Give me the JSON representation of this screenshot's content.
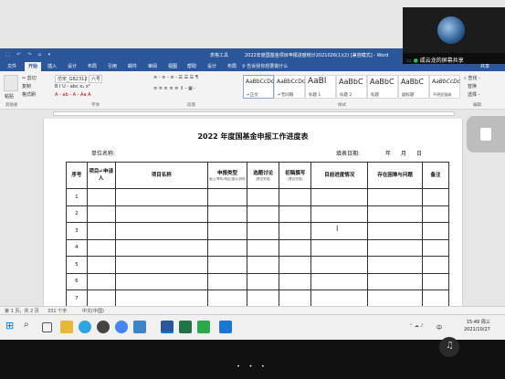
{
  "window": {
    "quick_access": "⬚ ↶ ↷ ⌂ ▾",
    "tools_tab": "表格工具",
    "doc_title": "2022年度国基金项目申报进度统计2021026(1)(2) [兼容模式] - Word"
  },
  "ribbon_tabs": [
    "文件",
    "开始",
    "插入",
    "设计",
    "布局",
    "引用",
    "邮件",
    "审阅",
    "视图",
    "帮助",
    "设计",
    "布局"
  ],
  "active_tab_index": 1,
  "tell_me": "告诉我你想要做什么",
  "share": "共享",
  "ribbon": {
    "paste": "粘贴",
    "cut": "✂ 剪切",
    "copy": "复制",
    "painter": "格式刷",
    "font_name": "仿宋_GB2312",
    "font_size": "六号",
    "font_buttons": "B I U - abc x₂ x²",
    "font_color_row": "A - ab - A - Aa A",
    "para_row1": "≡ - ≡ - ≡ - ☰ ☰ ☰ ¶",
    "para_row2": "≡ ≡ ≡ ≡ ≡ ↕ - ▦ -",
    "styles": [
      {
        "sample": "AaBbCcDc",
        "name": "↵正文"
      },
      {
        "sample": "AaBbCcDc",
        "name": "↵无间隔"
      },
      {
        "sample": "AaBl",
        "name": "标题 1"
      },
      {
        "sample": "AaBbC",
        "name": "标题 2"
      },
      {
        "sample": "AaBbC",
        "name": "标题"
      },
      {
        "sample": "AaBbC",
        "name": "副标题"
      },
      {
        "sample": "AaBbCcDc",
        "name": "不明显强调"
      }
    ],
    "find": "⌕ 查找 -",
    "replace": "替换",
    "select": "选择 -",
    "groups": [
      "剪贴板",
      "字体",
      "段落",
      "样式",
      "编辑"
    ]
  },
  "document": {
    "title": "2022 年度国基金申报工作进度表",
    "unit_label": "单位名称:",
    "date_label": "填表日期:",
    "year": "年",
    "month": "月",
    "day": "日",
    "headers": [
      {
        "label": "序号",
        "sub": ""
      },
      {
        "label": "项目↵申请人",
        "sub": ""
      },
      {
        "label": "项目名称",
        "sub": ""
      },
      {
        "label": "申报类型",
        "sub": "面上/青年/地区/重点/其他"
      },
      {
        "label": "选题讨论",
        "sub": "(是否完成)"
      },
      {
        "label": "初稿撰写",
        "sub": "(是否完成)"
      },
      {
        "label": "目前进度情况",
        "sub": ""
      },
      {
        "label": "存在困难与问题",
        "sub": ""
      },
      {
        "label": "备注",
        "sub": ""
      }
    ],
    "rows": [
      "1",
      "2",
      "3",
      "4",
      "5",
      "6",
      "7"
    ]
  },
  "statusbar": {
    "page": "第 1 页，共 2 页",
    "words": "331 个字",
    "lang": "中文(中国)"
  },
  "taskbar": {
    "time": "15:49 周三",
    "date": "2021/10/27",
    "ime": "中"
  },
  "video": {
    "caption": "咸云龙的屏幕共享"
  },
  "carousel": "• • •",
  "colors": {
    "word_blue": "#2b579a",
    "ribbon_bg": "#f3f3f3",
    "page_bg": "#ffffff"
  }
}
